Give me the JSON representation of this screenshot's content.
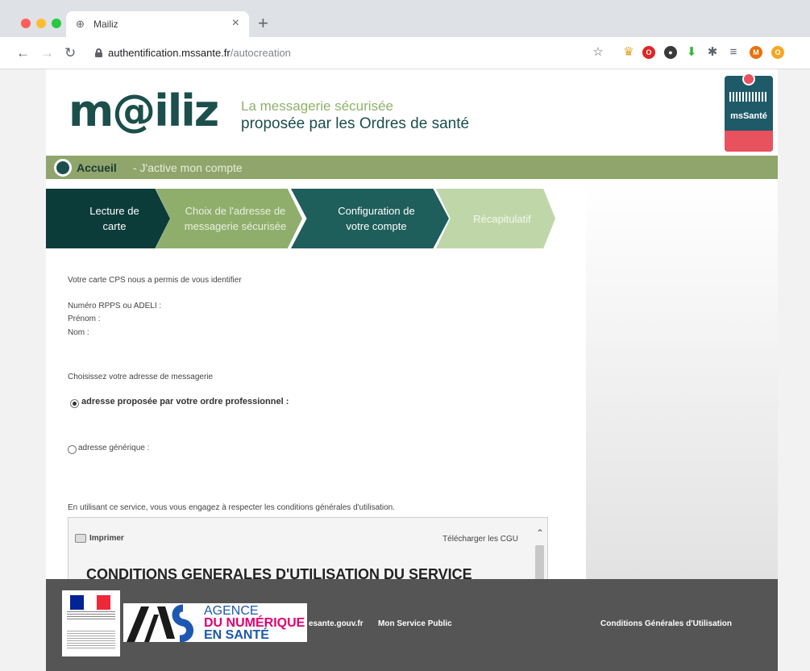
{
  "browser": {
    "tab_title": "Mailiz",
    "tab_close": "×",
    "new_tab": "+",
    "url_host": "authentification.mssante.fr",
    "url_path": "/autocreation"
  },
  "header": {
    "logo_text": "m@iliz",
    "tagline_1": "La messagerie sécurisée",
    "tagline_2": "proposée par les Ordres de santé",
    "badge_text": "msSanté"
  },
  "breadcrumb": {
    "home": "Accueil",
    "current": "- J'active mon compte"
  },
  "steps": [
    {
      "line1": "Lecture de",
      "line2": "carte"
    },
    {
      "line1": "Choix de l'adresse de",
      "line2": "messagerie sécurisée"
    },
    {
      "line1": "Configuration de",
      "line2": "votre compte"
    },
    {
      "line1": "Récapitulatif",
      "line2": ""
    }
  ],
  "identity": {
    "intro": "Votre carte CPS nous a permis de vous identifier",
    "rpps_label": "Numéro RPPS ou ADELI :",
    "firstname_label": "Prénom :",
    "lastname_label": "Nom :"
  },
  "address": {
    "prompt": "Choisissez votre adresse de messagerie",
    "option_professional": "adresse proposée par votre ordre professionnel :",
    "option_generic": "adresse générique :",
    "selected": "professional"
  },
  "cgu": {
    "notice": "En utilisant ce service, vous vous engagez à respecter les conditions générales d'utilisation.",
    "print": "Imprimer",
    "download": "Télécharger les CGU",
    "heading": "CONDITIONS GENERALES D'UTILISATION DU SERVICE"
  },
  "footer": {
    "ans_line1": "AGENCE",
    "ans_line2": "DU NUMÉRIQUE",
    "ans_line3": "EN SANTÉ",
    "link_esante": "esante.gouv.fr",
    "link_service_public": "Mon Service Public",
    "link_cgu": "Conditions Générales d'Utilisation"
  },
  "colors": {
    "dark_teal": "#0b3c3a",
    "olive_green": "#8fa56c",
    "footer_gray": "#555555",
    "ans_blue": "#1d58b0",
    "ans_pink": "#e2006f"
  }
}
